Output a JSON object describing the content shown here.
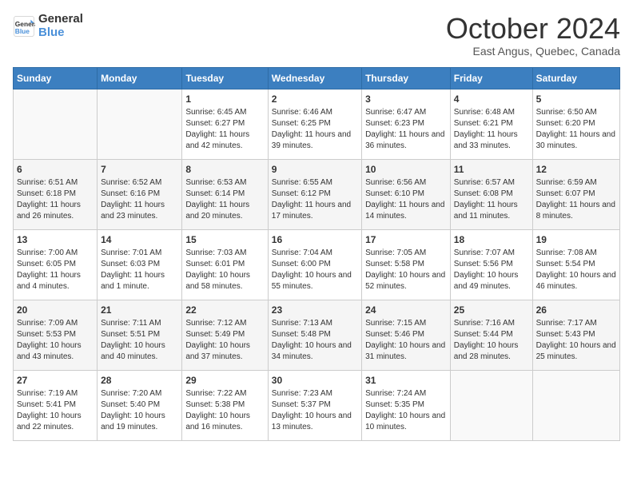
{
  "logo": {
    "line1": "General",
    "line2": "Blue"
  },
  "title": "October 2024",
  "subtitle": "East Angus, Quebec, Canada",
  "days_header": [
    "Sunday",
    "Monday",
    "Tuesday",
    "Wednesday",
    "Thursday",
    "Friday",
    "Saturday"
  ],
  "weeks": [
    [
      {
        "day": "",
        "info": ""
      },
      {
        "day": "",
        "info": ""
      },
      {
        "day": "1",
        "info": "Sunrise: 6:45 AM\nSunset: 6:27 PM\nDaylight: 11 hours and 42 minutes."
      },
      {
        "day": "2",
        "info": "Sunrise: 6:46 AM\nSunset: 6:25 PM\nDaylight: 11 hours and 39 minutes."
      },
      {
        "day": "3",
        "info": "Sunrise: 6:47 AM\nSunset: 6:23 PM\nDaylight: 11 hours and 36 minutes."
      },
      {
        "day": "4",
        "info": "Sunrise: 6:48 AM\nSunset: 6:21 PM\nDaylight: 11 hours and 33 minutes."
      },
      {
        "day": "5",
        "info": "Sunrise: 6:50 AM\nSunset: 6:20 PM\nDaylight: 11 hours and 30 minutes."
      }
    ],
    [
      {
        "day": "6",
        "info": "Sunrise: 6:51 AM\nSunset: 6:18 PM\nDaylight: 11 hours and 26 minutes."
      },
      {
        "day": "7",
        "info": "Sunrise: 6:52 AM\nSunset: 6:16 PM\nDaylight: 11 hours and 23 minutes."
      },
      {
        "day": "8",
        "info": "Sunrise: 6:53 AM\nSunset: 6:14 PM\nDaylight: 11 hours and 20 minutes."
      },
      {
        "day": "9",
        "info": "Sunrise: 6:55 AM\nSunset: 6:12 PM\nDaylight: 11 hours and 17 minutes."
      },
      {
        "day": "10",
        "info": "Sunrise: 6:56 AM\nSunset: 6:10 PM\nDaylight: 11 hours and 14 minutes."
      },
      {
        "day": "11",
        "info": "Sunrise: 6:57 AM\nSunset: 6:08 PM\nDaylight: 11 hours and 11 minutes."
      },
      {
        "day": "12",
        "info": "Sunrise: 6:59 AM\nSunset: 6:07 PM\nDaylight: 11 hours and 8 minutes."
      }
    ],
    [
      {
        "day": "13",
        "info": "Sunrise: 7:00 AM\nSunset: 6:05 PM\nDaylight: 11 hours and 4 minutes."
      },
      {
        "day": "14",
        "info": "Sunrise: 7:01 AM\nSunset: 6:03 PM\nDaylight: 11 hours and 1 minute."
      },
      {
        "day": "15",
        "info": "Sunrise: 7:03 AM\nSunset: 6:01 PM\nDaylight: 10 hours and 58 minutes."
      },
      {
        "day": "16",
        "info": "Sunrise: 7:04 AM\nSunset: 6:00 PM\nDaylight: 10 hours and 55 minutes."
      },
      {
        "day": "17",
        "info": "Sunrise: 7:05 AM\nSunset: 5:58 PM\nDaylight: 10 hours and 52 minutes."
      },
      {
        "day": "18",
        "info": "Sunrise: 7:07 AM\nSunset: 5:56 PM\nDaylight: 10 hours and 49 minutes."
      },
      {
        "day": "19",
        "info": "Sunrise: 7:08 AM\nSunset: 5:54 PM\nDaylight: 10 hours and 46 minutes."
      }
    ],
    [
      {
        "day": "20",
        "info": "Sunrise: 7:09 AM\nSunset: 5:53 PM\nDaylight: 10 hours and 43 minutes."
      },
      {
        "day": "21",
        "info": "Sunrise: 7:11 AM\nSunset: 5:51 PM\nDaylight: 10 hours and 40 minutes."
      },
      {
        "day": "22",
        "info": "Sunrise: 7:12 AM\nSunset: 5:49 PM\nDaylight: 10 hours and 37 minutes."
      },
      {
        "day": "23",
        "info": "Sunrise: 7:13 AM\nSunset: 5:48 PM\nDaylight: 10 hours and 34 minutes."
      },
      {
        "day": "24",
        "info": "Sunrise: 7:15 AM\nSunset: 5:46 PM\nDaylight: 10 hours and 31 minutes."
      },
      {
        "day": "25",
        "info": "Sunrise: 7:16 AM\nSunset: 5:44 PM\nDaylight: 10 hours and 28 minutes."
      },
      {
        "day": "26",
        "info": "Sunrise: 7:17 AM\nSunset: 5:43 PM\nDaylight: 10 hours and 25 minutes."
      }
    ],
    [
      {
        "day": "27",
        "info": "Sunrise: 7:19 AM\nSunset: 5:41 PM\nDaylight: 10 hours and 22 minutes."
      },
      {
        "day": "28",
        "info": "Sunrise: 7:20 AM\nSunset: 5:40 PM\nDaylight: 10 hours and 19 minutes."
      },
      {
        "day": "29",
        "info": "Sunrise: 7:22 AM\nSunset: 5:38 PM\nDaylight: 10 hours and 16 minutes."
      },
      {
        "day": "30",
        "info": "Sunrise: 7:23 AM\nSunset: 5:37 PM\nDaylight: 10 hours and 13 minutes."
      },
      {
        "day": "31",
        "info": "Sunrise: 7:24 AM\nSunset: 5:35 PM\nDaylight: 10 hours and 10 minutes."
      },
      {
        "day": "",
        "info": ""
      },
      {
        "day": "",
        "info": ""
      }
    ]
  ]
}
